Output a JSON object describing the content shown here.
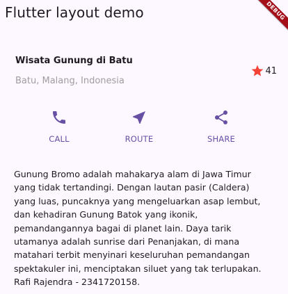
{
  "app_bar": {
    "title": "Flutter layout demo",
    "debug_banner": "DEBUG"
  },
  "title_section": {
    "name": "Wisata Gunung di Batu",
    "location": "Batu, Malang, Indonesia",
    "rating_count": "41",
    "star_icon": "star-icon",
    "star_color": "#f44336"
  },
  "buttons": [
    {
      "label": "CALL",
      "icon": "phone-icon"
    },
    {
      "label": "ROUTE",
      "icon": "navigation-icon"
    },
    {
      "label": "SHARE",
      "icon": "share-icon"
    }
  ],
  "accent_color": "#6750a4",
  "description": "Gunung Bromo adalah mahakarya alam di Jawa Timur\nyang tidak tertandingi. Dengan lautan pasir (Caldera)\nyang luas, puncaknya yang mengeluarkan asap lembut,\ndan kehadiran Gunung Batok yang ikonik,\npemandangannya bagai di planet lain. Daya tarik\nutamanya adalah sunrise dari Penanjakan, di mana\nmatahari terbit menyinari keseluruhan pemandangan\nspektakuler ini, menciptakan siluet yang tak terlupakan.\nRafi Rajendra - 2341720158."
}
